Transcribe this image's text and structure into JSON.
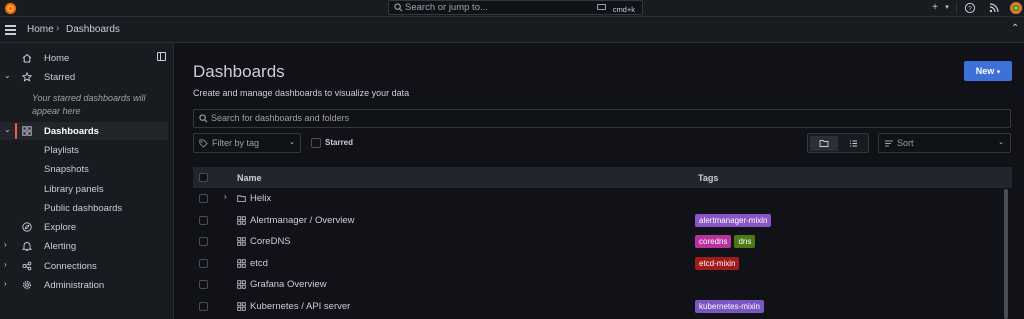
{
  "topbar": {
    "search_placeholder": "Search or jump to...",
    "shortcut": "cmd+k",
    "icons": [
      "grafana-logo-icon",
      "search-icon",
      "keyboard-icon",
      "plus-icon",
      "chevron-down-icon",
      "help-icon",
      "rss-icon",
      "avatar"
    ]
  },
  "breadcrumb": {
    "home": "Home",
    "separator": "›",
    "current": "Dashboards"
  },
  "sidebar": {
    "items": [
      {
        "label": "Home",
        "icon": "home-icon"
      },
      {
        "label": "Starred",
        "icon": "star-icon"
      },
      {
        "label": "Dashboards",
        "icon": "grid-icon"
      },
      {
        "label": "Playlists"
      },
      {
        "label": "Snapshots"
      },
      {
        "label": "Library panels"
      },
      {
        "label": "Public dashboards"
      },
      {
        "label": "Explore",
        "icon": "compass-icon"
      },
      {
        "label": "Alerting",
        "icon": "bell-icon"
      },
      {
        "label": "Connections",
        "icon": "connections-icon"
      },
      {
        "label": "Administration",
        "icon": "gear-icon"
      }
    ],
    "starred_empty": "Your starred dashboards will appear here"
  },
  "main": {
    "title": "Dashboards",
    "subtitle": "Create and manage dashboards to visualize your data",
    "new_button": "New",
    "search_placeholder": "Search for dashboards and folders",
    "filter_tag_placeholder": "Filter by tag",
    "starred_label": "Starred",
    "sort_placeholder": "Sort",
    "table": {
      "col_name": "Name",
      "col_tags": "Tags",
      "rows": [
        {
          "name": "Helix",
          "type": "folder",
          "tags": []
        },
        {
          "name": "Alertmanager / Overview",
          "type": "dashboard",
          "tags": [
            {
              "label": "alertmanager-mixin",
              "color": "#8a55c4"
            }
          ]
        },
        {
          "name": "CoreDNS",
          "type": "dashboard",
          "tags": [
            {
              "label": "coredns",
              "color": "#b8329e"
            },
            {
              "label": "dns",
              "color": "#4b7a12"
            }
          ]
        },
        {
          "name": "etcd",
          "type": "dashboard",
          "tags": [
            {
              "label": "etcd-mixin",
              "color": "#a11b1b"
            }
          ]
        },
        {
          "name": "Grafana Overview",
          "type": "dashboard",
          "tags": []
        },
        {
          "name": "Kubernetes / API server",
          "type": "dashboard",
          "tags": [
            {
              "label": "kubernetes-mixin",
              "color": "#7a55c4"
            }
          ]
        }
      ]
    }
  },
  "colors": {
    "accent": "#3d71d9",
    "active_indicator": "#f55f3e",
    "background": "#111217",
    "panel": "#181b1f"
  }
}
